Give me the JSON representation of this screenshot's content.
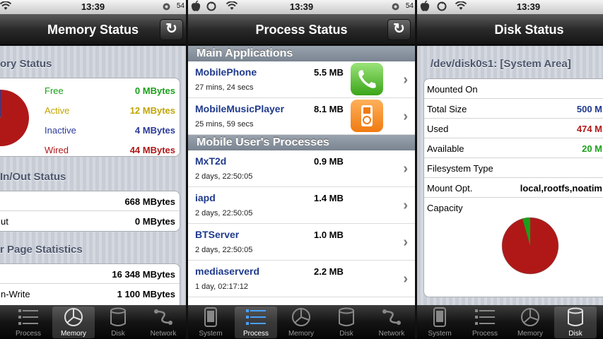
{
  "status_bar": {
    "time": "13:39",
    "battery": "54"
  },
  "memory_panel": {
    "title": "Memory Status",
    "section1": "ory Status",
    "legend": [
      {
        "label": "Free",
        "value": "0 MBytes",
        "color": "#1aa01a"
      },
      {
        "label": "Active",
        "value": "12 MBytes",
        "color": "#c2a400"
      },
      {
        "label": "Inactive",
        "value": "4 MBytes",
        "color": "#2a3b9a"
      },
      {
        "label": "Wired",
        "value": "44 MBytes",
        "color": "#b01818"
      }
    ],
    "section2": "In/Out Status",
    "inout_rows": [
      {
        "label": "",
        "value": "668 MBytes"
      },
      {
        "label": "ut",
        "value": "0 MBytes"
      }
    ],
    "section3": "r Page Statistics",
    "page_rows": [
      {
        "label": "",
        "value": "16 348 MBytes"
      },
      {
        "label": "n-Write",
        "value": "1 100 MBytes"
      }
    ]
  },
  "process_panel": {
    "title": "Process Status",
    "section_main": "Main Applications",
    "main_apps": [
      {
        "name": "MobilePhone",
        "mem": "5.5 MB",
        "time": "27 mins, 24 secs",
        "icon": "phone-app-icon"
      },
      {
        "name": "MobileMusicPlayer",
        "mem": "8.1 MB",
        "time": "25 mins, 59 secs",
        "icon": "ipod-app-icon"
      }
    ],
    "section_user": "Mobile User's Processes",
    "user_procs": [
      {
        "name": "MxT2d",
        "mem": "0.9 MB",
        "time": "2 days, 22:50:05"
      },
      {
        "name": "iapd",
        "mem": "1.4 MB",
        "time": "2 days, 22:50:05"
      },
      {
        "name": "BTServer",
        "mem": "1.0 MB",
        "time": "2 days, 22:50:05"
      },
      {
        "name": "mediaserverd",
        "mem": "2.2 MB",
        "time": "1 day, 02:17:12"
      }
    ]
  },
  "disk_panel": {
    "title": "Disk Status",
    "volume": "/dev/disk0s1: [System Area]",
    "rows": [
      {
        "label": "Mounted On",
        "value": ""
      },
      {
        "label": "Total Size",
        "value": "500 M",
        "color": "#1f3a8c"
      },
      {
        "label": "Used",
        "value": "474 M",
        "color": "#b01818"
      },
      {
        "label": "Available",
        "value": "20 M",
        "color": "#1aa01a"
      },
      {
        "label": "Filesystem Type",
        "value": ""
      },
      {
        "label": "Mount Opt.",
        "value": "local,rootfs,noatim",
        "color": "#000000"
      },
      {
        "label": "Capacity",
        "value": ""
      }
    ]
  },
  "tabs_panel1": [
    {
      "label": "Process",
      "icon": "list-icon",
      "active": false
    },
    {
      "label": "Memory",
      "icon": "pie-icon",
      "active": true
    },
    {
      "label": "Disk",
      "icon": "disk-icon",
      "active": false
    },
    {
      "label": "Network",
      "icon": "network-icon",
      "active": false
    }
  ],
  "tabs_panel2": [
    {
      "label": "System",
      "icon": "phone-icon",
      "active": false
    },
    {
      "label": "Process",
      "icon": "list-icon",
      "active": true
    },
    {
      "label": "Memory",
      "icon": "pie-icon",
      "active": false
    },
    {
      "label": "Disk",
      "icon": "disk-icon",
      "active": false
    },
    {
      "label": "Network",
      "icon": "network-icon",
      "active": false
    }
  ],
  "tabs_panel3": [
    {
      "label": "System",
      "icon": "phone-icon",
      "active": false
    },
    {
      "label": "Process",
      "icon": "list-icon",
      "active": false
    },
    {
      "label": "Memory",
      "icon": "pie-icon",
      "active": false
    },
    {
      "label": "Disk",
      "icon": "disk-icon",
      "active": true
    }
  ]
}
